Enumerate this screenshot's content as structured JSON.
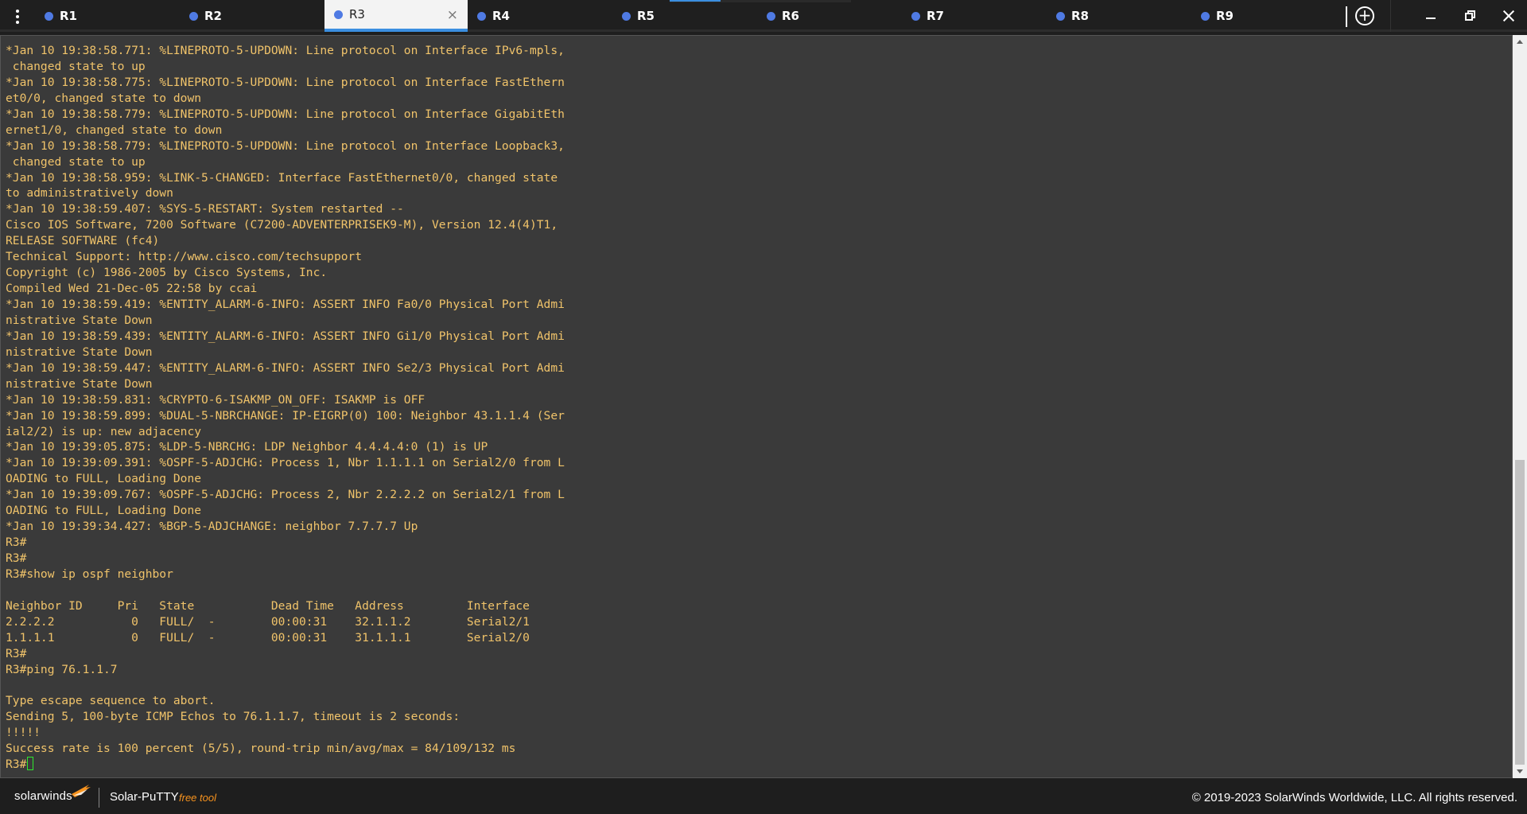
{
  "tabs": [
    {
      "label": "R1",
      "status_color": "#4f7ae3",
      "active": false
    },
    {
      "label": "R2",
      "status_color": "#4f7ae3",
      "active": false
    },
    {
      "label": "R3",
      "status_color": "#4f7ae3",
      "active": true
    },
    {
      "label": "R4",
      "status_color": "#4f7ae3",
      "active": false
    },
    {
      "label": "R5",
      "status_color": "#4f7ae3",
      "active": false
    },
    {
      "label": "R6",
      "status_color": "#4f7ae3",
      "active": false
    },
    {
      "label": "R7",
      "status_color": "#4f7ae3",
      "active": false
    },
    {
      "label": "R8",
      "status_color": "#4f7ae3",
      "active": false
    },
    {
      "label": "R9",
      "status_color": "#4f7ae3",
      "active": false
    }
  ],
  "tab_close_glyph": "×",
  "add_tab_glyph": "+",
  "terminal": {
    "text_color": "#f0c36a",
    "background": "#3a3a3a",
    "prompt": "R3#",
    "lines": [
      "*Jan 10 19:38:58.771: %LINEPROTO-5-UPDOWN: Line protocol on Interface IPv6-mpls,",
      " changed state to up",
      "*Jan 10 19:38:58.775: %LINEPROTO-5-UPDOWN: Line protocol on Interface FastEthern",
      "et0/0, changed state to down",
      "*Jan 10 19:38:58.779: %LINEPROTO-5-UPDOWN: Line protocol on Interface GigabitEth",
      "ernet1/0, changed state to down",
      "*Jan 10 19:38:58.779: %LINEPROTO-5-UPDOWN: Line protocol on Interface Loopback3,",
      " changed state to up",
      "*Jan 10 19:38:58.959: %LINK-5-CHANGED: Interface FastEthernet0/0, changed state",
      "to administratively down",
      "*Jan 10 19:38:59.407: %SYS-5-RESTART: System restarted --",
      "Cisco IOS Software, 7200 Software (C7200-ADVENTERPRISEK9-M), Version 12.4(4)T1,",
      "RELEASE SOFTWARE (fc4)",
      "Technical Support: http://www.cisco.com/techsupport",
      "Copyright (c) 1986-2005 by Cisco Systems, Inc.",
      "Compiled Wed 21-Dec-05 22:58 by ccai",
      "*Jan 10 19:38:59.419: %ENTITY_ALARM-6-INFO: ASSERT INFO Fa0/0 Physical Port Admi",
      "nistrative State Down",
      "*Jan 10 19:38:59.439: %ENTITY_ALARM-6-INFO: ASSERT INFO Gi1/0 Physical Port Admi",
      "nistrative State Down",
      "*Jan 10 19:38:59.447: %ENTITY_ALARM-6-INFO: ASSERT INFO Se2/3 Physical Port Admi",
      "nistrative State Down",
      "*Jan 10 19:38:59.831: %CRYPTO-6-ISAKMP_ON_OFF: ISAKMP is OFF",
      "*Jan 10 19:38:59.899: %DUAL-5-NBRCHANGE: IP-EIGRP(0) 100: Neighbor 43.1.1.4 (Ser",
      "ial2/2) is up: new adjacency",
      "*Jan 10 19:39:05.875: %LDP-5-NBRCHG: LDP Neighbor 4.4.4.4:0 (1) is UP",
      "*Jan 10 19:39:09.391: %OSPF-5-ADJCHG: Process 1, Nbr 1.1.1.1 on Serial2/0 from L",
      "OADING to FULL, Loading Done",
      "*Jan 10 19:39:09.767: %OSPF-5-ADJCHG: Process 2, Nbr 2.2.2.2 on Serial2/1 from L",
      "OADING to FULL, Loading Done",
      "*Jan 10 19:39:34.427: %BGP-5-ADJCHANGE: neighbor 7.7.7.7 Up",
      "R3#",
      "R3#",
      "R3#show ip ospf neighbor",
      "",
      "Neighbor ID     Pri   State           Dead Time   Address         Interface",
      "2.2.2.2           0   FULL/  -        00:00:31    32.1.1.2        Serial2/1",
      "1.1.1.1           0   FULL/  -        00:00:31    31.1.1.1        Serial2/0",
      "R3#",
      "R3#ping 76.1.1.7",
      "",
      "Type escape sequence to abort.",
      "Sending 5, 100-byte ICMP Echos to 76.1.1.7, timeout is 2 seconds:",
      "!!!!!",
      "Success rate is 100 percent (5/5), round-trip min/avg/max = 84/109/132 ms"
    ]
  },
  "footer": {
    "logo_text": "solarwinds",
    "product_name": "Solar-PuTTY",
    "product_tag": "free tool",
    "copyright": "© 2019-2023 SolarWinds Worldwide, LLC. All rights reserved.",
    "accent_color": "#f7931e"
  }
}
